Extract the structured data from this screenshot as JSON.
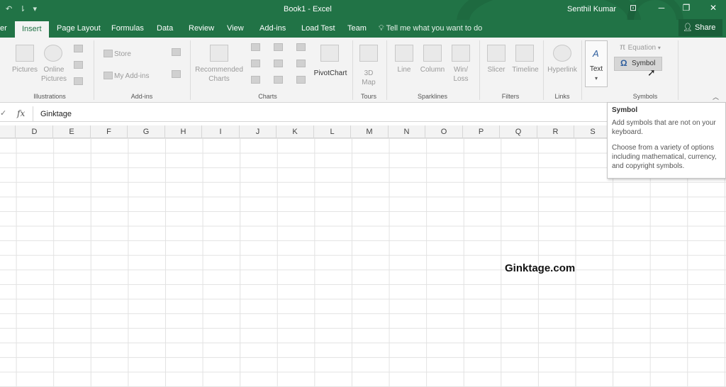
{
  "titlebar": {
    "qat": [
      "↶",
      "⇂",
      "▾"
    ],
    "title": "Book1  -  Excel",
    "user": "Senthil Kumar",
    "controls": [
      "⊡",
      "─",
      "❐",
      "✕"
    ]
  },
  "tabs": {
    "items": [
      "er",
      "Insert",
      "Page Layout",
      "Formulas",
      "Data",
      "Review",
      "View",
      "Add-ins",
      "Load Test",
      "Team"
    ],
    "active": "Insert",
    "tell_me": "Tell me what you want to do",
    "share": "Share"
  },
  "ribbon": {
    "illustrations": {
      "pictures": "Pictures",
      "online_pictures_1": "Online",
      "online_pictures_2": "Pictures",
      "label": "Illustrations"
    },
    "addins": {
      "store": "Store",
      "my_addins": "My Add-ins",
      "label": "Add-ins"
    },
    "charts": {
      "recommended_1": "Recommended",
      "recommended_2": "Charts",
      "pivotchart": "PivotChart",
      "label": "Charts"
    },
    "tours": {
      "map_1": "3D",
      "map_2": "Map",
      "label": "Tours"
    },
    "sparklines": {
      "line": "Line",
      "column": "Column",
      "winloss_1": "Win/",
      "winloss_2": "Loss",
      "label": "Sparklines"
    },
    "filters": {
      "slicer": "Slicer",
      "timeline": "Timeline",
      "label": "Filters"
    },
    "links": {
      "hyperlink": "Hyperlink",
      "label": "Links"
    },
    "text": {
      "text": "Text"
    },
    "symbols": {
      "equation": "Equation",
      "symbol": "Symbol",
      "label": "Symbols"
    }
  },
  "formula_bar": {
    "fx": "fx",
    "value": "Ginktage"
  },
  "columns": [
    "D",
    "E",
    "F",
    "G",
    "H",
    "I",
    "J",
    "K",
    "L",
    "M",
    "N",
    "O",
    "P",
    "Q",
    "R",
    "S"
  ],
  "watermark": "Ginktage.com",
  "tooltip": {
    "title": "Symbol",
    "line1": "Add symbols that are not on your keyboard.",
    "line2": "Choose from a variety of options including mathematical, currency, and copyright symbols."
  },
  "colors": {
    "accent": "#217346",
    "ribbon": "#f3f3f3"
  }
}
